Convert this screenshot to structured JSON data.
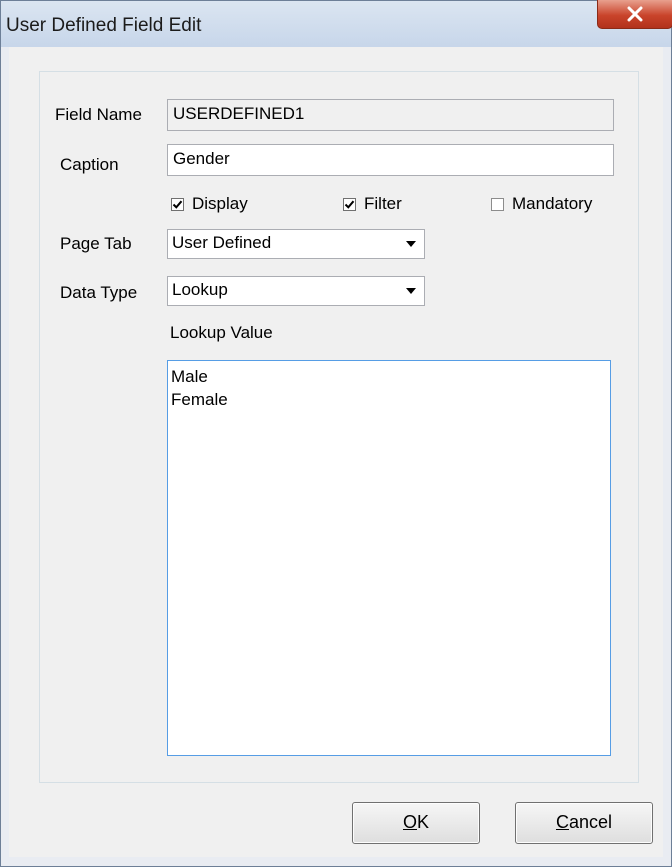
{
  "window": {
    "title": "User Defined Field Edit",
    "close_glyph": "X"
  },
  "form": {
    "field_name_label": "Field Name",
    "field_name_value": "USERDEFINED1",
    "caption_label": "Caption",
    "caption_value": "Gender",
    "display_label": "Display",
    "display_checked": true,
    "filter_label": "Filter",
    "filter_checked": true,
    "mandatory_label": "Mandatory",
    "mandatory_checked": false,
    "page_tab_label": "Page Tab",
    "page_tab_value": "User Defined",
    "data_type_label": "Data Type",
    "data_type_value": "Lookup",
    "lookup_label": "Lookup Value",
    "lookup_values": [
      "Male",
      "Female"
    ]
  },
  "buttons": {
    "ok_mnemonic": "O",
    "ok_rest": "K",
    "cancel_mnemonic": "C",
    "cancel_rest": "ancel"
  },
  "icons": {
    "close": "close-icon",
    "check": "checkmark-icon",
    "dropdown": "chevron-down-icon"
  }
}
